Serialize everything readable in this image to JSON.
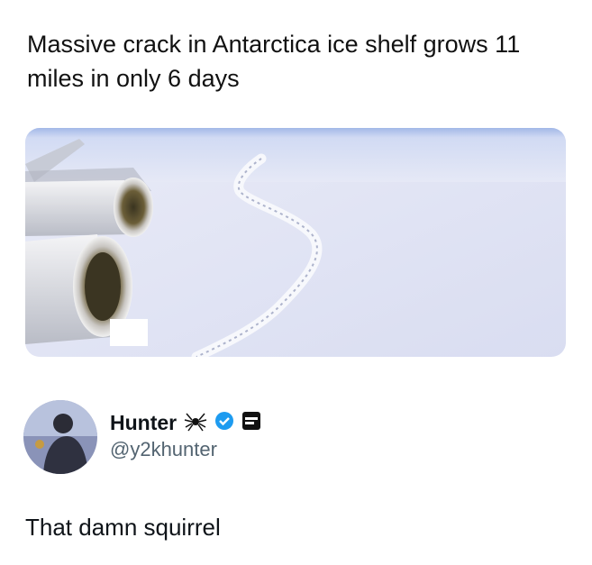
{
  "post": {
    "headline": "Massive crack in Antarctica ice shelf grows 11 miles in only 6 days"
  },
  "media": {
    "image": "aerial-view-of-ice-shelf-crack-from-airplane-window"
  },
  "author": {
    "display_name": "Hunter",
    "handle": "@y2khunter",
    "badges": [
      "spider-icon",
      "verified-badge-icon",
      "label-badge-icon"
    ],
    "verified_color": "#1d9bf0"
  },
  "reply": {
    "text": "That damn squirrel"
  }
}
